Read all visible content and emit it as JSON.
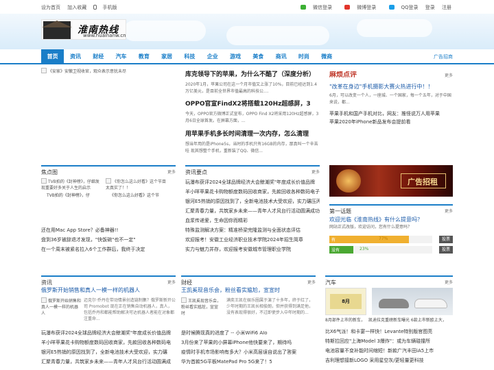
{
  "topbar": {
    "left": [
      "设为首页",
      "加入收藏",
      "手机版"
    ],
    "right": [
      "微信登录",
      "微博登录",
      "QQ登录",
      "登录",
      "注册"
    ]
  },
  "logo": {
    "title": "淮南热线",
    "sub": "www.huainanw.cn"
  },
  "nav": {
    "items": [
      "首页",
      "资讯",
      "财经",
      "汽车",
      "教育",
      "家居",
      "科技",
      "企业",
      "游戏",
      "美食",
      "商讯",
      "时尚",
      "微商"
    ],
    "ad": "广告招商"
  },
  "lead": {
    "img_alt": "《安家》安徽卫视收官，观众表示意犹未尽"
  },
  "news": [
    {
      "title": "库克领导下的苹果，为什么不酷了（深度分析）",
      "desc": "2020年1月，苹果公司在这一个月市值又上涨了10%，目前已经达到1.4万亿美元，是目前全世界市值最高的科技公...."
    },
    {
      "title": "OPPO官宣FindX2将搭载120Hz超感屏，3",
      "desc": "今天，OPPO官方微博正式宣布，OPPO Find X2将采用120Hz超感屏，3月6日全球首发。在屏幕方面，..."
    },
    {
      "title": "用苹果手机多长时间清理一次内存，怎么清理",
      "desc": "想当年用的是iPhone5s，当时的手机只有16GB的内存，那真叫一个辛苦哇 现其想整个手机，重新装了QQ、微信..."
    }
  ],
  "review": {
    "badge": "麻烦点评",
    "more": "更多",
    "headline": "\"改革在身边\"手机摄影大赛火热进行中！！",
    "desc": "6月，可以改变一个人，一座城、一个国家，每一个五年，对于中国来说，都...",
    "items": [
      "苹果手机和国产手机对比，网友：推怪说万人用苹果",
      "苹果2020年iPhone新品发布会提前看"
    ]
  },
  "focus": {
    "title": "焦点图",
    "more": "更多",
    "items": [
      {
        "img": "TVB拍的《封神榜》，仔细发现重要好多关于人生的启示",
        "cap": "TVB拍的《封神榜》，仔"
      },
      {
        "img": "《你怎么这么好看》这个节目太真实了！！",
        "cap": "《你怎么这么好看》这个节"
      }
    ],
    "links": [
      "还在用Mac App Store？必备神器!!",
      "盘到36岁被辞退才发现，\"快饭碗\"也不一定\"",
      "在一个周末被紧名拉入6个工作群后，我终于决定"
    ]
  },
  "zixun_top": {
    "title": "资讯要点",
    "more": "更多",
    "items": [
      "玩瀑布获评2024全球品牌经济大会鲸潮奖\"年度成长价值品牌",
      "羊小咩苹果花卡购物额度数码回收商家，先款回收各种数码电子产",
      "银河E5热销的原因找到了，全新电池技术大受欢迎，实力碾压丙",
      "汇聚青春力量，共筑家乡未来——青年人才风台行活动圆满成功",
      "血浆传递爱，生命因你而精彩",
      "特殊监测解决方案：精准桥梁完隆监测与全面状态评估",
      "欢迎报考！安徽工业经济职业技术学院2024年招生简章",
      "实力与魅力并存，欢迎报考安徽城市管理职业学院"
    ]
  },
  "banner": {
    "text": "广告招租"
  },
  "topic": {
    "title": "第一话题",
    "more": "更多",
    "headline": "欢迎光临《淮南热线》有什么提意吗？",
    "desc": "网站正式改版，欢迎访问，您有什么提意吗？",
    "options": [
      {
        "label": "有",
        "pct": "77%",
        "btn": "投票",
        "value": 77
      },
      {
        "label": "没有",
        "pct": "23%",
        "btn": "投票",
        "value": 23
      }
    ]
  },
  "zixun": {
    "title": "资讯",
    "more": "更多",
    "head": "俄罗斯开始销售和真人一模一样的机器人",
    "img": "俄罗斯开始销售和真人一模一样的机器人",
    "desc": "迈克尔·乔丹在带动情景创造链制集？俄罗斯新开公司 Promobot 现在正在销售自动机器人，真人，包括乔丹和都能帮助解决可达机器人者能在对象都注重命...",
    "links": [
      "玩瀑布获评2024全球品牌经济大会鲸潮奖\"年度成长价值品牌",
      "羊小咩苹果花卡购物额度数码回收商家，先款回收各种数码电",
      "银河E5热销的原因找到了，全新电池技术大受欢迎，实力碾",
      "汇聚青春力量，共筑家乡未来——青年人才风台行活动圆满成"
    ]
  },
  "caijing": {
    "title": "财经",
    "more": "更多",
    "head": "王凯奚现音乐会，粉丝看实尴尬，宣宣时",
    "img": "王凯奚现音乐会，粉丝看实尴尬，宣宣时",
    "desc": "满奕王凯在娱乐圈属于演了十多年，终于红了，少年时期的王凯长相俊朗，但并获得到满足他，没有表现得很好，不过即使步入中年时期的...",
    "links": [
      "是时候腾现真的进度了 -- 小米WiFi6 AIo",
      "3月份来了苹果的小屏幕iPhone他快要来了，期待吗",
      "疫情时手机市场影响有多大？小米高层误自说出了答案",
      "华为首款5G平板MatePad Pro 5G来了！5"
    ]
  },
  "auto": {
    "title": "汽车",
    "more": "更多",
    "caps": [
      "8月部件上市的新车，",
      "凯迪拉克重磅新车曝光 6款上市新欧上大，"
    ],
    "links": [
      "比X6气派！和卡宴一样快！Levante特别版官图亮",
      "特斯拉回应\"上海Model 3爆炸\"：或为车辆碰撞所",
      "电池容量不变补能时间缩短！新款广汽丰田iA5上市",
      "吉利理想接新LOGO 采用星空灰/更轻量更科技"
    ]
  }
}
